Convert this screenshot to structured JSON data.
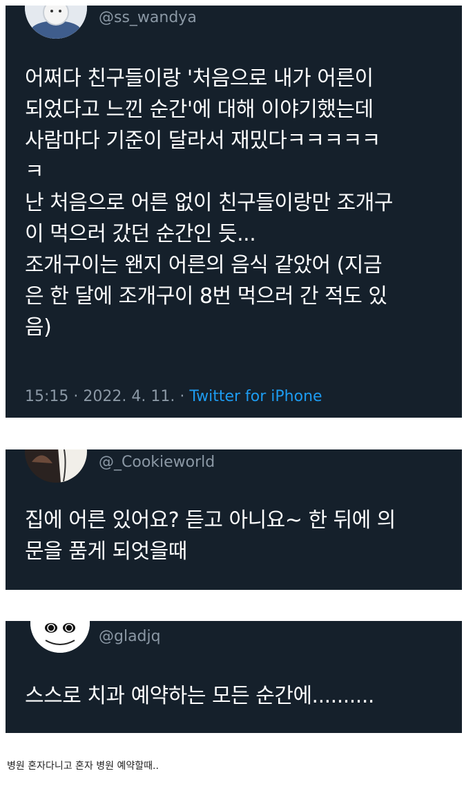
{
  "tweets": [
    {
      "handle": "@ss_wandya",
      "avatar_icon": "cartoon-cat-avatar",
      "lines": [
        "어쩌다 친구들이랑 '처음으로 내가 어른이",
        "되었다고 느낀 순간'에 대해 이야기했는데",
        "사람마다 기준이 달라서 재밌다ㅋㅋㅋㅋㅋ",
        "ㅋ",
        "난 처음으로 어른 없이 친구들이랑만 조개구",
        "이 먹으러 갔던 순간인 듯...",
        "조개구이는 왠지 어른의 음식 같았어 (지금",
        "은 한 달에 조개구이 8번 먹으러 간 적도 있",
        "음)"
      ],
      "time": "15:15 · 2022. 4. 11. · ",
      "source": "Twitter for iPhone"
    },
    {
      "handle": "@_Cookieworld",
      "avatar_icon": "dark-illustration-avatar",
      "lines": [
        "집에 어른 있어요? 듣고 아니요~ 한 뒤에 의",
        "문을 품게 되엇을때"
      ]
    },
    {
      "handle": "@gladjq",
      "avatar_icon": "panda-doodle-avatar",
      "lines": [
        "스스로 치과 예약하는 모든 순간에.........."
      ]
    }
  ],
  "caption": "병원 혼자다니고 혼자 병원 예약할때..",
  "colors": {
    "card_bg": "#15202b",
    "handle": "#8b98a5",
    "text": "#ffffff",
    "link": "#1d9bf0"
  }
}
